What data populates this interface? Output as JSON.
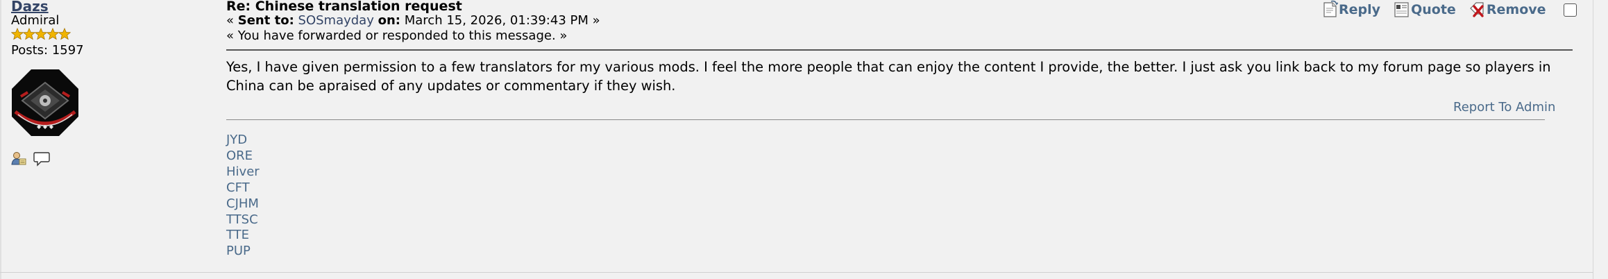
{
  "poster": {
    "name": "Dazs",
    "rank": "Admiral",
    "stars": 5,
    "posts": "Posts: 1597",
    "icons": [
      "profile-icon",
      "speech-bubble-icon"
    ]
  },
  "message": {
    "subject": "Re: Chinese translation request",
    "meta": {
      "prefix": "«",
      "sent_to_label": "Sent to:",
      "recipient": "SOSmayday",
      "on_label": "on:",
      "date": "March 15, 2026, 01:39:43 PM",
      "suffix": "»"
    },
    "notice": "« You have forwarded or responded to this message. »",
    "body_line1": "Yes, I have given permission to a few translators for my various mods. I feel the more people that can enjoy the content I provide, the better. I just ask you link back to my forum page so players in",
    "body_line2": "China can be apraised of any updates or commentary if they wish.",
    "report": "Report To Admin"
  },
  "actions": {
    "reply": "Reply",
    "quote": "Quote",
    "remove": "Remove"
  },
  "signature": [
    "JYD",
    "ORE",
    "Hiver",
    "CFT",
    "CJHM",
    "TTSC",
    "TTE",
    "PUP"
  ],
  "colors": {
    "link": "#4a6a8a",
    "star": "#f0b400",
    "background": "#f1f1f1"
  }
}
